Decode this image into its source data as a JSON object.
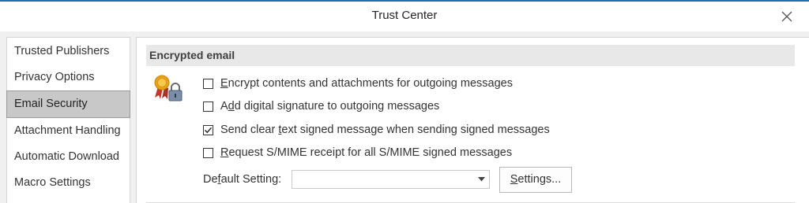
{
  "window": {
    "title": "Trust Center",
    "close_icon": "close-icon"
  },
  "sidebar": {
    "items": [
      {
        "label": "Trusted Publishers",
        "selected": false
      },
      {
        "label": "Privacy Options",
        "selected": false
      },
      {
        "label": "Email Security",
        "selected": true
      },
      {
        "label": "Attachment Handling",
        "selected": false
      },
      {
        "label": "Automatic Download",
        "selected": false
      },
      {
        "label": "Macro Settings",
        "selected": false
      }
    ]
  },
  "encrypted_email": {
    "header": "Encrypted email",
    "icon": "certificate-lock-icon",
    "options": [
      {
        "accel": "E",
        "rest": "ncrypt contents and attachments for outgoing messages",
        "checked": false
      },
      {
        "prefix": "A",
        "accel": "d",
        "rest": "d digital signature to outgoing messages",
        "checked": false
      },
      {
        "prefix": "Send clear ",
        "accel": "t",
        "rest": "ext signed message when sending signed messages",
        "checked": true
      },
      {
        "accel": "R",
        "rest": "equest S/MIME receipt for all S/MIME signed messages",
        "checked": false
      }
    ],
    "default_setting": {
      "prefix": "De",
      "accel": "f",
      "rest": "ault Setting:",
      "value": ""
    },
    "settings_button": {
      "prefix": "",
      "accel": "S",
      "rest": "ettings..."
    }
  },
  "colors": {
    "accent": "#1e6fb8",
    "selected_item": "#c8c8c8",
    "section_header": "#e8e8e8"
  }
}
